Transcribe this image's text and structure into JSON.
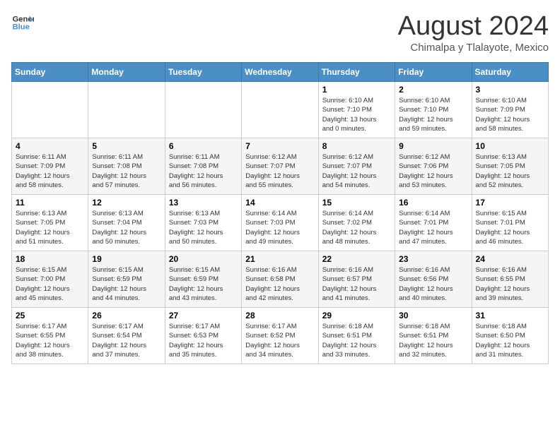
{
  "header": {
    "logo_line1": "General",
    "logo_line2": "Blue",
    "month_title": "August 2024",
    "subtitle": "Chimalpa y Tlalayote, Mexico"
  },
  "days_of_week": [
    "Sunday",
    "Monday",
    "Tuesday",
    "Wednesday",
    "Thursday",
    "Friday",
    "Saturday"
  ],
  "weeks": [
    [
      {
        "day": "",
        "info": ""
      },
      {
        "day": "",
        "info": ""
      },
      {
        "day": "",
        "info": ""
      },
      {
        "day": "",
        "info": ""
      },
      {
        "day": "1",
        "info": "Sunrise: 6:10 AM\nSunset: 7:10 PM\nDaylight: 13 hours\nand 0 minutes."
      },
      {
        "day": "2",
        "info": "Sunrise: 6:10 AM\nSunset: 7:10 PM\nDaylight: 12 hours\nand 59 minutes."
      },
      {
        "day": "3",
        "info": "Sunrise: 6:10 AM\nSunset: 7:09 PM\nDaylight: 12 hours\nand 58 minutes."
      }
    ],
    [
      {
        "day": "4",
        "info": "Sunrise: 6:11 AM\nSunset: 7:09 PM\nDaylight: 12 hours\nand 58 minutes."
      },
      {
        "day": "5",
        "info": "Sunrise: 6:11 AM\nSunset: 7:08 PM\nDaylight: 12 hours\nand 57 minutes."
      },
      {
        "day": "6",
        "info": "Sunrise: 6:11 AM\nSunset: 7:08 PM\nDaylight: 12 hours\nand 56 minutes."
      },
      {
        "day": "7",
        "info": "Sunrise: 6:12 AM\nSunset: 7:07 PM\nDaylight: 12 hours\nand 55 minutes."
      },
      {
        "day": "8",
        "info": "Sunrise: 6:12 AM\nSunset: 7:07 PM\nDaylight: 12 hours\nand 54 minutes."
      },
      {
        "day": "9",
        "info": "Sunrise: 6:12 AM\nSunset: 7:06 PM\nDaylight: 12 hours\nand 53 minutes."
      },
      {
        "day": "10",
        "info": "Sunrise: 6:13 AM\nSunset: 7:05 PM\nDaylight: 12 hours\nand 52 minutes."
      }
    ],
    [
      {
        "day": "11",
        "info": "Sunrise: 6:13 AM\nSunset: 7:05 PM\nDaylight: 12 hours\nand 51 minutes."
      },
      {
        "day": "12",
        "info": "Sunrise: 6:13 AM\nSunset: 7:04 PM\nDaylight: 12 hours\nand 50 minutes."
      },
      {
        "day": "13",
        "info": "Sunrise: 6:13 AM\nSunset: 7:03 PM\nDaylight: 12 hours\nand 50 minutes."
      },
      {
        "day": "14",
        "info": "Sunrise: 6:14 AM\nSunset: 7:03 PM\nDaylight: 12 hours\nand 49 minutes."
      },
      {
        "day": "15",
        "info": "Sunrise: 6:14 AM\nSunset: 7:02 PM\nDaylight: 12 hours\nand 48 minutes."
      },
      {
        "day": "16",
        "info": "Sunrise: 6:14 AM\nSunset: 7:01 PM\nDaylight: 12 hours\nand 47 minutes."
      },
      {
        "day": "17",
        "info": "Sunrise: 6:15 AM\nSunset: 7:01 PM\nDaylight: 12 hours\nand 46 minutes."
      }
    ],
    [
      {
        "day": "18",
        "info": "Sunrise: 6:15 AM\nSunset: 7:00 PM\nDaylight: 12 hours\nand 45 minutes."
      },
      {
        "day": "19",
        "info": "Sunrise: 6:15 AM\nSunset: 6:59 PM\nDaylight: 12 hours\nand 44 minutes."
      },
      {
        "day": "20",
        "info": "Sunrise: 6:15 AM\nSunset: 6:59 PM\nDaylight: 12 hours\nand 43 minutes."
      },
      {
        "day": "21",
        "info": "Sunrise: 6:16 AM\nSunset: 6:58 PM\nDaylight: 12 hours\nand 42 minutes."
      },
      {
        "day": "22",
        "info": "Sunrise: 6:16 AM\nSunset: 6:57 PM\nDaylight: 12 hours\nand 41 minutes."
      },
      {
        "day": "23",
        "info": "Sunrise: 6:16 AM\nSunset: 6:56 PM\nDaylight: 12 hours\nand 40 minutes."
      },
      {
        "day": "24",
        "info": "Sunrise: 6:16 AM\nSunset: 6:55 PM\nDaylight: 12 hours\nand 39 minutes."
      }
    ],
    [
      {
        "day": "25",
        "info": "Sunrise: 6:17 AM\nSunset: 6:55 PM\nDaylight: 12 hours\nand 38 minutes."
      },
      {
        "day": "26",
        "info": "Sunrise: 6:17 AM\nSunset: 6:54 PM\nDaylight: 12 hours\nand 37 minutes."
      },
      {
        "day": "27",
        "info": "Sunrise: 6:17 AM\nSunset: 6:53 PM\nDaylight: 12 hours\nand 35 minutes."
      },
      {
        "day": "28",
        "info": "Sunrise: 6:17 AM\nSunset: 6:52 PM\nDaylight: 12 hours\nand 34 minutes."
      },
      {
        "day": "29",
        "info": "Sunrise: 6:18 AM\nSunset: 6:51 PM\nDaylight: 12 hours\nand 33 minutes."
      },
      {
        "day": "30",
        "info": "Sunrise: 6:18 AM\nSunset: 6:51 PM\nDaylight: 12 hours\nand 32 minutes."
      },
      {
        "day": "31",
        "info": "Sunrise: 6:18 AM\nSunset: 6:50 PM\nDaylight: 12 hours\nand 31 minutes."
      }
    ]
  ]
}
